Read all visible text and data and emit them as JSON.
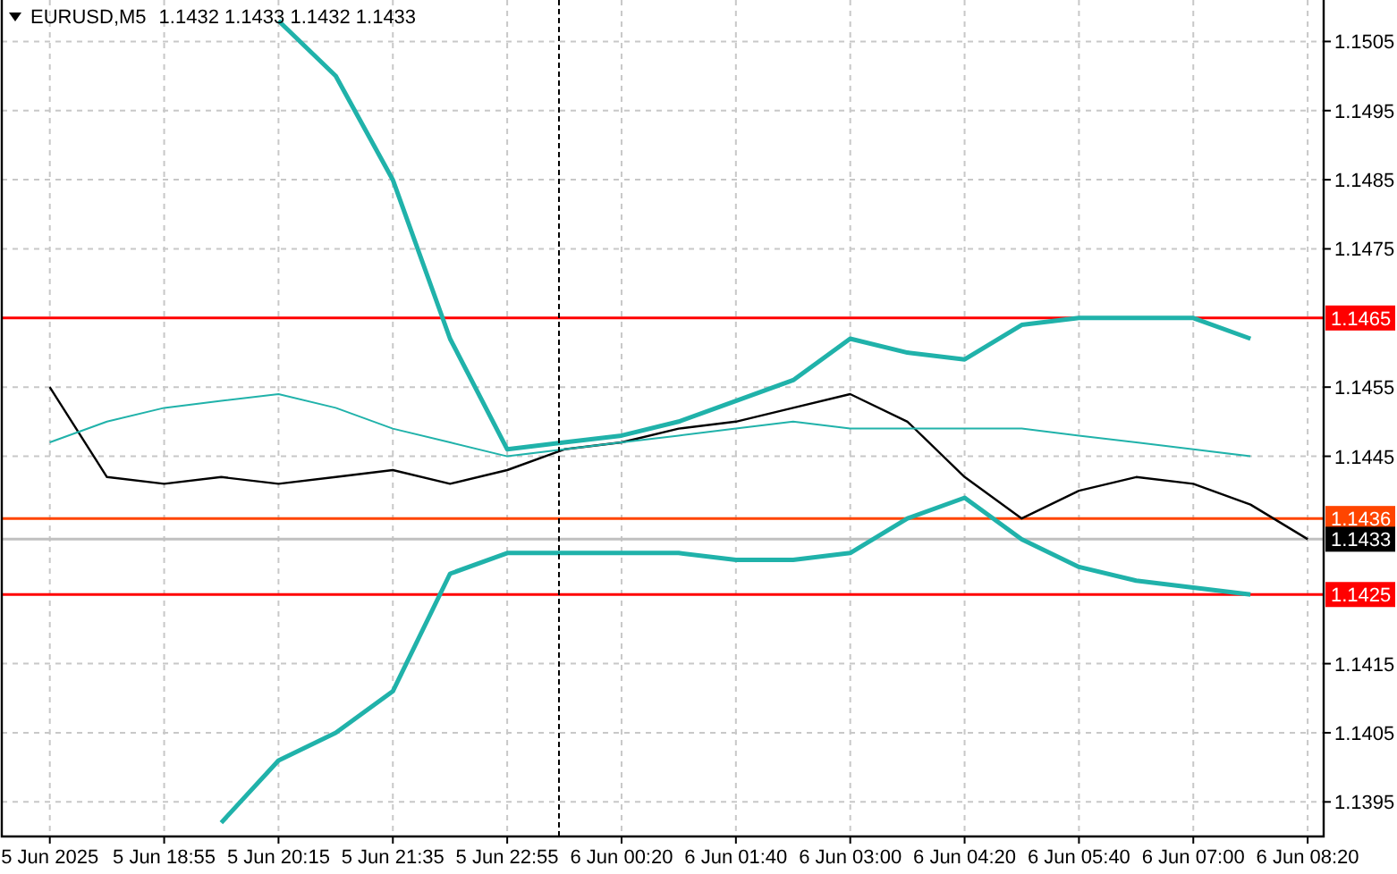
{
  "chart": {
    "header": {
      "symbol": "EURUSD,M5",
      "quote": "1.1432 1.1433 1.1432 1.1433"
    },
    "chart_data": {
      "type": "line",
      "grid": true,
      "ylim": [
        1.139,
        1.1511
      ],
      "categories": [
        "5 Jun 2025",
        null,
        "5 Jun 18:55",
        null,
        "5 Jun 20:15",
        null,
        "5 Jun 21:35",
        null,
        "5 Jun 22:55",
        null,
        "6 Jun 00:20",
        null,
        "6 Jun 01:40",
        null,
        "6 Jun 03:00",
        null,
        "6 Jun 04:20",
        null,
        "6 Jun 05:40",
        null,
        "6 Jun 07:00",
        null,
        "6 Jun 08:20"
      ],
      "yticks": [
        1.1505,
        1.1495,
        1.1485,
        1.1475,
        1.1455,
        1.1445,
        1.1415,
        1.1405,
        1.1395
      ],
      "series": [
        {
          "color": "#000000",
          "values": [
            1.1455,
            1.1442,
            1.1441,
            1.1442,
            1.1441,
            1.1442,
            1.1443,
            1.1441,
            1.1443,
            1.1446,
            1.1447,
            1.1449,
            1.145,
            1.1452,
            1.1454,
            1.145,
            1.1442,
            1.1436,
            1.144,
            1.1442,
            1.1441,
            1.1438,
            1.1433
          ]
        },
        {
          "color": "#20b2aa",
          "values": [
            null,
            null,
            null,
            null,
            1.1508,
            1.15,
            1.1485,
            1.1462,
            1.1446,
            1.1447,
            1.1448,
            1.145,
            1.1453,
            1.1456,
            1.1462,
            1.146,
            1.1459,
            1.1464,
            1.1465,
            1.1465,
            1.1465,
            1.1462,
            null
          ]
        },
        {
          "color": "#20b2aa",
          "values": [
            1.1447,
            1.145,
            1.1452,
            1.1453,
            1.1454,
            1.1452,
            1.1449,
            1.1447,
            1.1445,
            1.1446,
            1.1447,
            1.1448,
            1.1449,
            1.145,
            1.1449,
            1.1449,
            1.1449,
            1.1449,
            1.1448,
            1.1447,
            1.1446,
            1.1445,
            null
          ]
        },
        {
          "color": "#20b2aa",
          "values": [
            null,
            null,
            null,
            1.1392,
            1.1401,
            1.1405,
            1.1411,
            1.1428,
            1.1431,
            1.1431,
            1.1431,
            1.1431,
            1.143,
            1.143,
            1.1431,
            1.1436,
            1.1439,
            1.1433,
            1.1429,
            1.1427,
            1.1426,
            1.1425,
            null
          ]
        }
      ],
      "ref_lines": [
        {
          "axis": "y",
          "value": 1.1465,
          "label": "1.1465",
          "color": "#ff0000"
        },
        {
          "axis": "y",
          "value": 1.1436,
          "label": "1.1436",
          "color": "#ff4500"
        },
        {
          "axis": "y",
          "value": 1.1433,
          "label": "1.1433",
          "color": "#c0c0c0"
        },
        {
          "axis": "y",
          "value": 1.1425,
          "label": "1.1425",
          "color": "#ff0000"
        }
      ]
    }
  }
}
